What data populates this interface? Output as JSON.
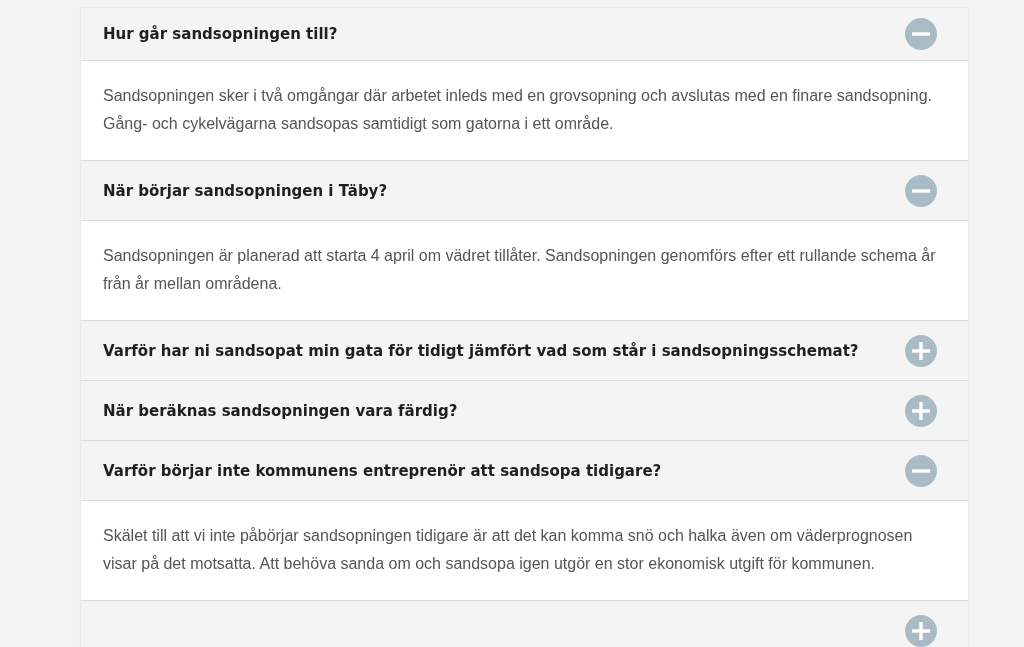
{
  "faq": [
    {
      "title": "Hur går sandsopningen till?",
      "expanded": true,
      "answer": "Sandsopningen sker i två omgångar där arbetet inleds med en grovsopning och avslutas med en finare sandsopning. Gång- och cykelvägarna sandsopas samtidigt som gatorna i ett område."
    },
    {
      "title": "När börjar sandsopningen i Täby?",
      "expanded": true,
      "answer": "Sandsopningen är planerad att starta 4 april om vädret tillåter. Sandsopningen genomförs efter ett rullande schema år från år mellan områdena."
    },
    {
      "title": "Varför har ni sandsopat min gata för tidigt jämfört vad som står i sandsopningsschemat?",
      "expanded": false
    },
    {
      "title": "När beräknas sandsopningen vara färdig?",
      "expanded": false
    },
    {
      "title": "Varför börjar inte kommunens entreprenör att sandsopa tidigare?",
      "expanded": true,
      "answer": "Skälet till att vi inte påbörjar sandsopningen tidigare är att det kan komma snö och halka även om väderprognosen visar på det motsatta. Att behöva sanda om och sandsopa igen utgör en stor ekonomisk utgift för kommunen."
    },
    {
      "expanded": false
    }
  ]
}
